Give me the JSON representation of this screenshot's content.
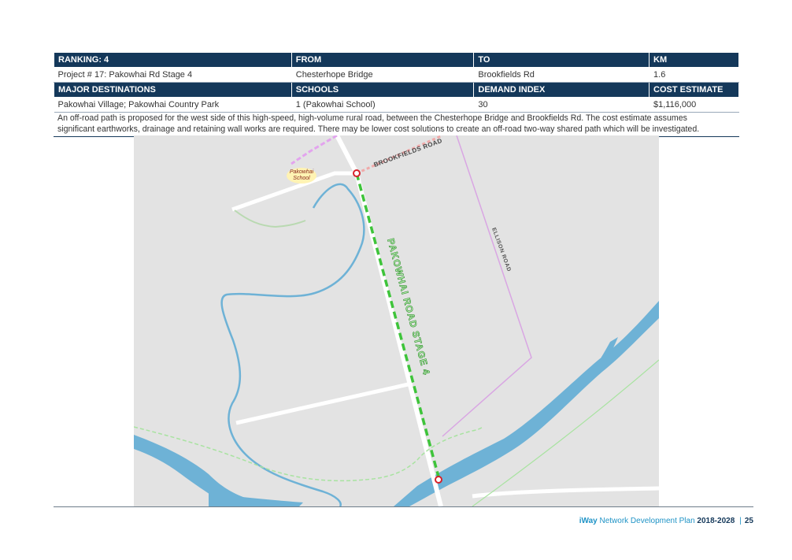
{
  "table": {
    "row1": {
      "ranking": "RANKING: 4",
      "from": "FROM",
      "to": "TO",
      "km": "KM"
    },
    "row2": {
      "project": "Project # 17: Pakowhai Rd Stage 4",
      "from": "Chesterhope Bridge",
      "to": "Brookfields Rd",
      "km": "1.6"
    },
    "row3": {
      "destinations": "MAJOR DESTINATIONS",
      "schools": "SCHOOLS",
      "demand": "DEMAND INDEX",
      "cost": "COST ESTIMATE"
    },
    "row4": {
      "destinations": "Pakowhai Village; Pakowhai Country Park",
      "schools": "1 (Pakowhai School)",
      "demand": "30",
      "cost": "$1,116,000"
    }
  },
  "description": {
    "line1": "An off-road path is proposed for the west side of this high-speed, high-volume rural road, between the Chesterhope Bridge and Brookfields Rd. The cost estimate assumes",
    "line2": "significant earthworks, drainage and retaining wall works are required. There may be lower cost solutions to create an off-road two-way shared path which will be investigated."
  },
  "map": {
    "school_label_1": "Pakowhai",
    "school_label_2": "School",
    "road_brookfields": "BROOKFIELDS ROAD",
    "road_stage4": "PAKOWHAI ROAD STAGE 4",
    "road_ellison": "ELLISON ROAD",
    "colors": {
      "land": "#e3e3e3",
      "road": "#ffffff",
      "river": "#6eb2d6",
      "proposed": "#3ec43a",
      "marker": "#d7212a"
    }
  },
  "footer": {
    "brand": "iWay",
    "plan": " Network Development Plan",
    "years": " 2018-2028",
    "sep": "|",
    "page": "25"
  }
}
